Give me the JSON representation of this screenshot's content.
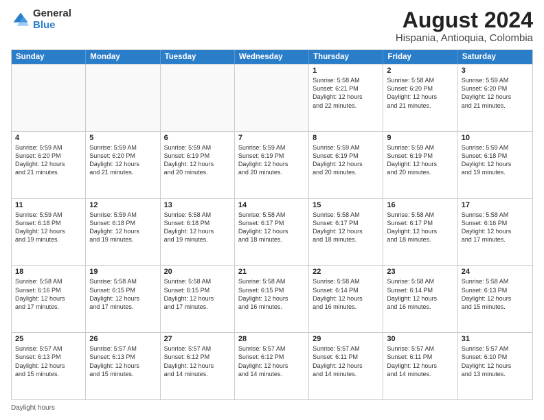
{
  "header": {
    "logo_general": "General",
    "logo_blue": "Blue",
    "month_title": "August 2024",
    "subtitle": "Hispania, Antioquia, Colombia"
  },
  "days_of_week": [
    "Sunday",
    "Monday",
    "Tuesday",
    "Wednesday",
    "Thursday",
    "Friday",
    "Saturday"
  ],
  "weeks": [
    [
      {
        "day": "",
        "info": ""
      },
      {
        "day": "",
        "info": ""
      },
      {
        "day": "",
        "info": ""
      },
      {
        "day": "",
        "info": ""
      },
      {
        "day": "1",
        "info": "Sunrise: 5:58 AM\nSunset: 6:21 PM\nDaylight: 12 hours\nand 22 minutes."
      },
      {
        "day": "2",
        "info": "Sunrise: 5:58 AM\nSunset: 6:20 PM\nDaylight: 12 hours\nand 21 minutes."
      },
      {
        "day": "3",
        "info": "Sunrise: 5:59 AM\nSunset: 6:20 PM\nDaylight: 12 hours\nand 21 minutes."
      }
    ],
    [
      {
        "day": "4",
        "info": "Sunrise: 5:59 AM\nSunset: 6:20 PM\nDaylight: 12 hours\nand 21 minutes."
      },
      {
        "day": "5",
        "info": "Sunrise: 5:59 AM\nSunset: 6:20 PM\nDaylight: 12 hours\nand 21 minutes."
      },
      {
        "day": "6",
        "info": "Sunrise: 5:59 AM\nSunset: 6:19 PM\nDaylight: 12 hours\nand 20 minutes."
      },
      {
        "day": "7",
        "info": "Sunrise: 5:59 AM\nSunset: 6:19 PM\nDaylight: 12 hours\nand 20 minutes."
      },
      {
        "day": "8",
        "info": "Sunrise: 5:59 AM\nSunset: 6:19 PM\nDaylight: 12 hours\nand 20 minutes."
      },
      {
        "day": "9",
        "info": "Sunrise: 5:59 AM\nSunset: 6:19 PM\nDaylight: 12 hours\nand 20 minutes."
      },
      {
        "day": "10",
        "info": "Sunrise: 5:59 AM\nSunset: 6:18 PM\nDaylight: 12 hours\nand 19 minutes."
      }
    ],
    [
      {
        "day": "11",
        "info": "Sunrise: 5:59 AM\nSunset: 6:18 PM\nDaylight: 12 hours\nand 19 minutes."
      },
      {
        "day": "12",
        "info": "Sunrise: 5:59 AM\nSunset: 6:18 PM\nDaylight: 12 hours\nand 19 minutes."
      },
      {
        "day": "13",
        "info": "Sunrise: 5:58 AM\nSunset: 6:18 PM\nDaylight: 12 hours\nand 19 minutes."
      },
      {
        "day": "14",
        "info": "Sunrise: 5:58 AM\nSunset: 6:17 PM\nDaylight: 12 hours\nand 18 minutes."
      },
      {
        "day": "15",
        "info": "Sunrise: 5:58 AM\nSunset: 6:17 PM\nDaylight: 12 hours\nand 18 minutes."
      },
      {
        "day": "16",
        "info": "Sunrise: 5:58 AM\nSunset: 6:17 PM\nDaylight: 12 hours\nand 18 minutes."
      },
      {
        "day": "17",
        "info": "Sunrise: 5:58 AM\nSunset: 6:16 PM\nDaylight: 12 hours\nand 17 minutes."
      }
    ],
    [
      {
        "day": "18",
        "info": "Sunrise: 5:58 AM\nSunset: 6:16 PM\nDaylight: 12 hours\nand 17 minutes."
      },
      {
        "day": "19",
        "info": "Sunrise: 5:58 AM\nSunset: 6:15 PM\nDaylight: 12 hours\nand 17 minutes."
      },
      {
        "day": "20",
        "info": "Sunrise: 5:58 AM\nSunset: 6:15 PM\nDaylight: 12 hours\nand 17 minutes."
      },
      {
        "day": "21",
        "info": "Sunrise: 5:58 AM\nSunset: 6:15 PM\nDaylight: 12 hours\nand 16 minutes."
      },
      {
        "day": "22",
        "info": "Sunrise: 5:58 AM\nSunset: 6:14 PM\nDaylight: 12 hours\nand 16 minutes."
      },
      {
        "day": "23",
        "info": "Sunrise: 5:58 AM\nSunset: 6:14 PM\nDaylight: 12 hours\nand 16 minutes."
      },
      {
        "day": "24",
        "info": "Sunrise: 5:58 AM\nSunset: 6:13 PM\nDaylight: 12 hours\nand 15 minutes."
      }
    ],
    [
      {
        "day": "25",
        "info": "Sunrise: 5:57 AM\nSunset: 6:13 PM\nDaylight: 12 hours\nand 15 minutes."
      },
      {
        "day": "26",
        "info": "Sunrise: 5:57 AM\nSunset: 6:13 PM\nDaylight: 12 hours\nand 15 minutes."
      },
      {
        "day": "27",
        "info": "Sunrise: 5:57 AM\nSunset: 6:12 PM\nDaylight: 12 hours\nand 14 minutes."
      },
      {
        "day": "28",
        "info": "Sunrise: 5:57 AM\nSunset: 6:12 PM\nDaylight: 12 hours\nand 14 minutes."
      },
      {
        "day": "29",
        "info": "Sunrise: 5:57 AM\nSunset: 6:11 PM\nDaylight: 12 hours\nand 14 minutes."
      },
      {
        "day": "30",
        "info": "Sunrise: 5:57 AM\nSunset: 6:11 PM\nDaylight: 12 hours\nand 14 minutes."
      },
      {
        "day": "31",
        "info": "Sunrise: 5:57 AM\nSunset: 6:10 PM\nDaylight: 12 hours\nand 13 minutes."
      }
    ]
  ],
  "footer": "Daylight hours"
}
